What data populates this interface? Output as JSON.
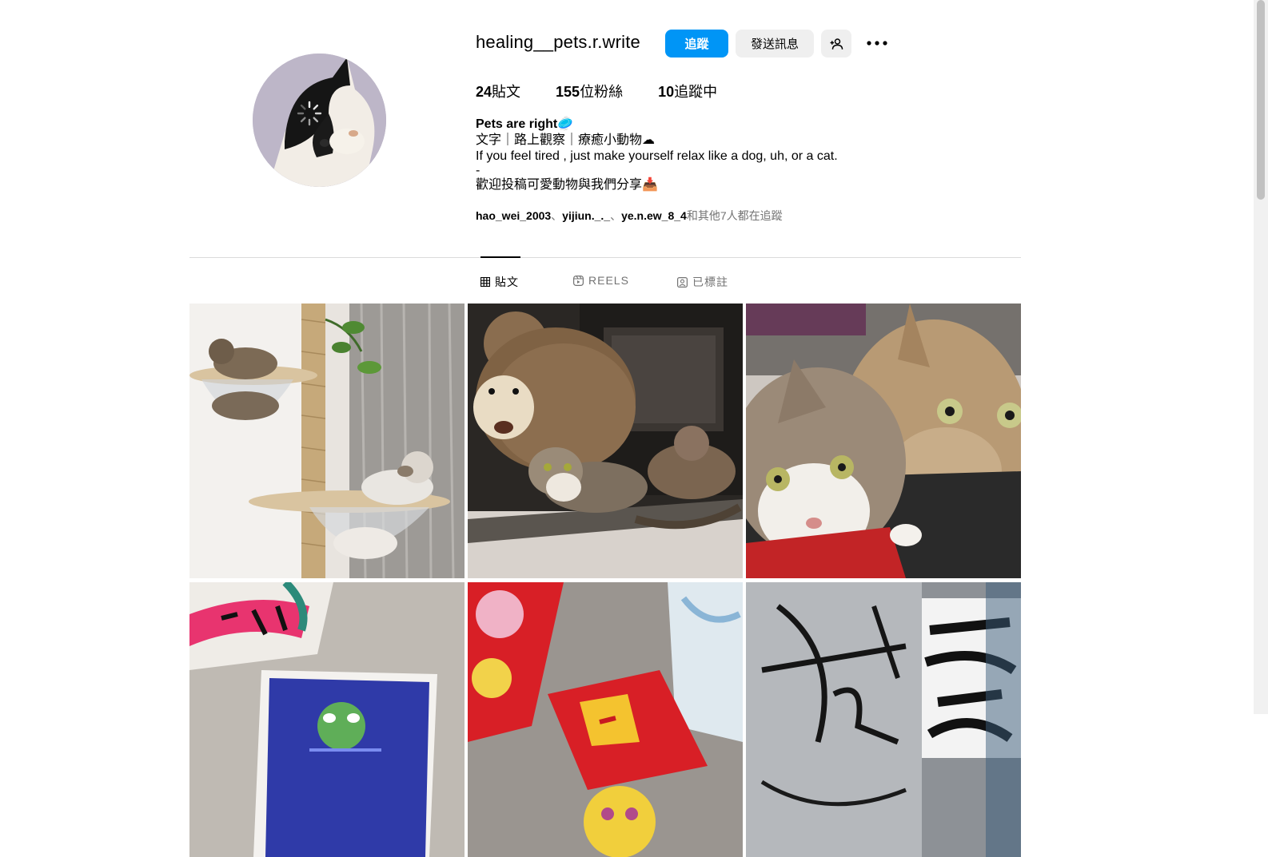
{
  "profile": {
    "username": "healing__pets.r.write",
    "follow_label": "追蹤",
    "message_label": "發送訊息",
    "suggest_icon": "add-person-icon",
    "more_icon": "more-horizontal-icon"
  },
  "stats": {
    "posts_count": "24",
    "posts_label": "貼文",
    "followers_count": "155",
    "followers_label": "位粉絲",
    "following_count": "10",
    "following_label": "追蹤中"
  },
  "bio": {
    "name": "Pets are right🥏",
    "line1": "文字｜路上觀察｜療癒小動物☁",
    "line2": "If you feel tired , just make yourself relax like a dog, uh, or a cat.",
    "line3": "-",
    "line4": "歡迎投稿可愛動物與我們分享📥"
  },
  "followed_by": {
    "user1": "hao_wei_2003",
    "sep1": "、",
    "user2": "yijiun._._",
    "sep2": "、",
    "user3": "ye.n.ew_8_4",
    "rest": "和其他7人都在追蹤"
  },
  "tabs": [
    {
      "label": "貼文",
      "icon": "grid-icon",
      "active": true
    },
    {
      "label": "REELS",
      "icon": "reels-icon",
      "active": false
    },
    {
      "label": "已標註",
      "icon": "tagged-icon",
      "active": false
    }
  ],
  "colors": {
    "accent": "#0095f6",
    "button_gray": "#efefef",
    "muted_text": "#737373"
  }
}
